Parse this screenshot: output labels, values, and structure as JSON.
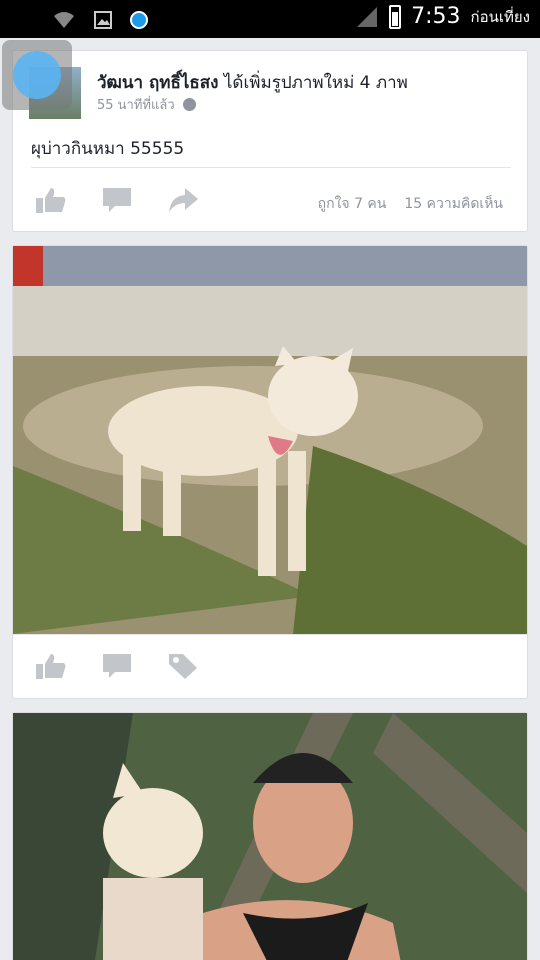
{
  "status_bar": {
    "time": "7:53",
    "ampm": "ก่อนเที่ยง",
    "icons": [
      "wifi-icon",
      "image-icon",
      "notification-dot-icon",
      "signal-icon",
      "battery-icon"
    ]
  },
  "post1": {
    "author": "วัฒนา ฤทธิ์ไธสง",
    "action": "ได้เพิ่มรูปภาพใหม่ 4 ภาพ",
    "time": "55 นาทีที่แล้ว",
    "text": "ผุบ่าวกินหมา 55555",
    "likes": "ถูกใจ 7 คน",
    "comments": "15 ความคิดเห็น"
  },
  "colors": {
    "icon_gray": "#c2c5ca",
    "text_dark": "#1d2129",
    "meta_gray": "#90949c",
    "accent_blue": "#1e9be8"
  }
}
